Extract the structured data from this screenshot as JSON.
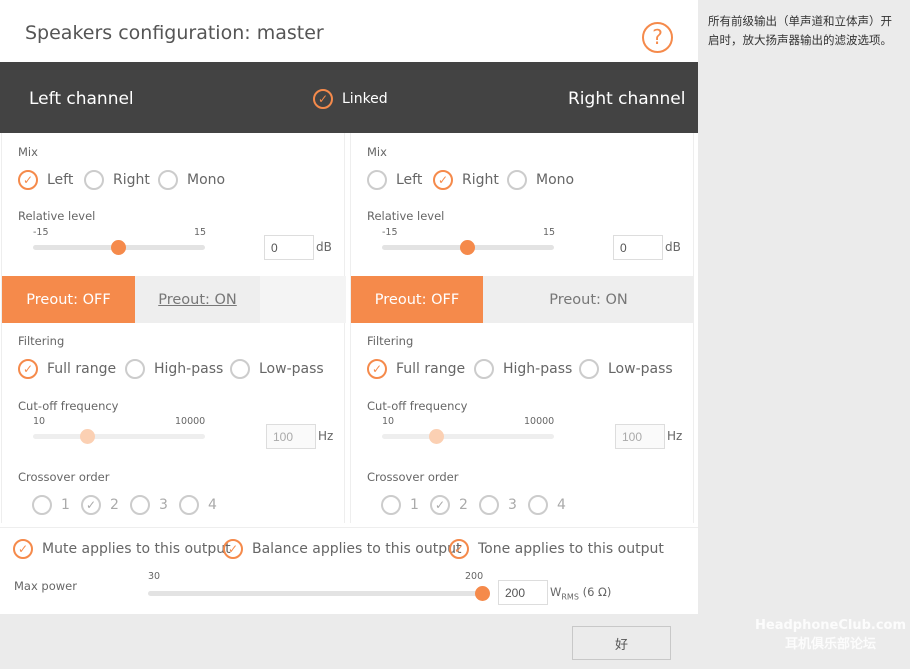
{
  "dialog": {
    "title": "Speakers configuration: master",
    "help_icon": "?"
  },
  "header": {
    "left": "Left channel",
    "linked": "Linked",
    "linked_checked": true,
    "right": "Right channel"
  },
  "accent": "#f58a4b",
  "channels": [
    {
      "mix_label": "Mix",
      "mix": [
        "Left",
        "Right",
        "Mono"
      ],
      "mix_selected": 0,
      "level_label": "Relative level",
      "level_min": "-15",
      "level_max": "15",
      "level_value": "0",
      "level_unit": "dB",
      "preout_off": "Preout: OFF",
      "preout_on": "Preout: ON",
      "preout_selected": "off",
      "filter_label": "Filtering",
      "filters": [
        "Full range",
        "High-pass",
        "Low-pass"
      ],
      "filter_selected": 0,
      "cutoff_label": "Cut-off frequency",
      "cutoff_min": "10",
      "cutoff_max": "10000",
      "cutoff_value": "100",
      "cutoff_unit": "Hz",
      "cutoff_position": 0.3,
      "crossover_label": "Crossover order",
      "orders": [
        "1",
        "2",
        "3",
        "4"
      ],
      "order_selected": 1
    },
    {
      "mix_label": "Mix",
      "mix": [
        "Left",
        "Right",
        "Mono"
      ],
      "mix_selected": 1,
      "level_label": "Relative level",
      "level_min": "-15",
      "level_max": "15",
      "level_value": "0",
      "level_unit": "dB",
      "preout_off": "Preout: OFF",
      "preout_on": "Preout: ON",
      "preout_selected": "off",
      "filter_label": "Filtering",
      "filters": [
        "Full range",
        "High-pass",
        "Low-pass"
      ],
      "filter_selected": 0,
      "cutoff_label": "Cut-off frequency",
      "cutoff_min": "10",
      "cutoff_max": "10000",
      "cutoff_value": "100",
      "cutoff_unit": "Hz",
      "cutoff_position": 0.3,
      "crossover_label": "Crossover order",
      "orders": [
        "1",
        "2",
        "3",
        "4"
      ],
      "order_selected": 1
    }
  ],
  "options": [
    {
      "label": "Mute applies to this output",
      "checked": true
    },
    {
      "label": "Balance applies to this output",
      "checked": true
    },
    {
      "label": "Tone applies to this output",
      "checked": true
    }
  ],
  "max_power": {
    "label": "Max power",
    "min": "30",
    "max": "200",
    "value": "200",
    "unit_w": "W",
    "unit_sub": "RMS",
    "unit_rest": "(6 Ω)"
  },
  "footer": {
    "ok": "好"
  },
  "side_help": "所有前级输出（单声道和立体声）开启时，放大扬声器输出的滤波选项。",
  "watermark": {
    "line1": "HeadphoneClub.com",
    "line2": "耳机俱乐部论坛"
  }
}
